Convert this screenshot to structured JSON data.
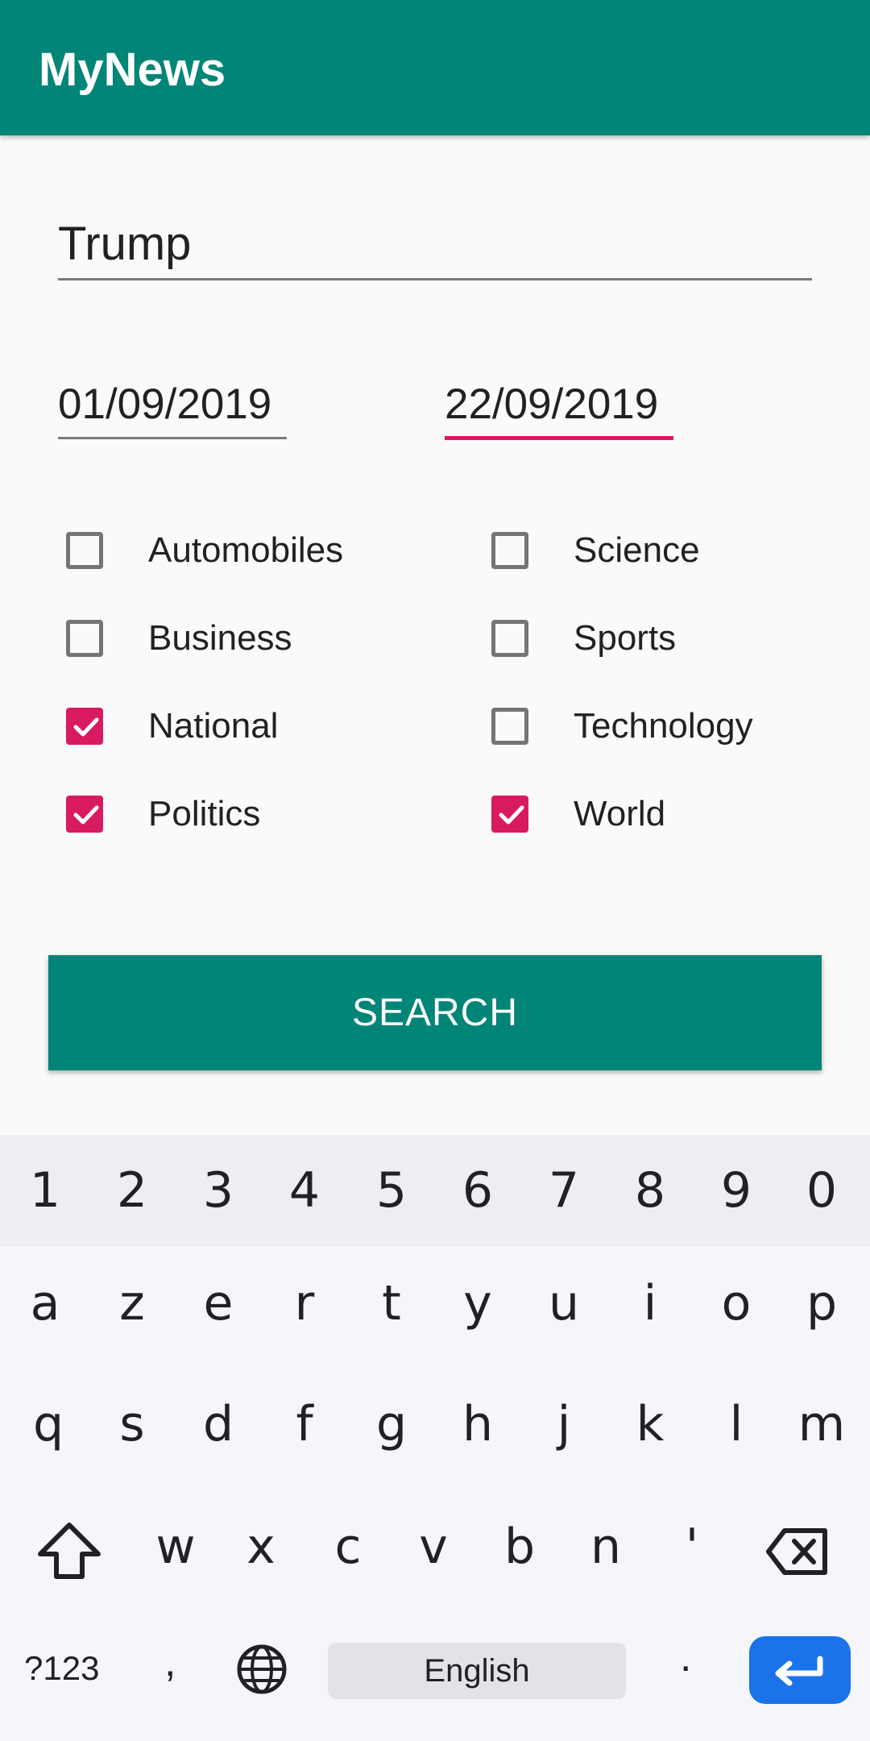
{
  "app": {
    "title": "MyNews"
  },
  "search": {
    "query": "Trump"
  },
  "dates": {
    "begin": "01/09/2019",
    "end": "22/09/2019"
  },
  "categories": [
    {
      "label": "Automobiles",
      "checked": false
    },
    {
      "label": "Science",
      "checked": false
    },
    {
      "label": "Business",
      "checked": false
    },
    {
      "label": "Sports",
      "checked": false
    },
    {
      "label": "National",
      "checked": true
    },
    {
      "label": "Technology",
      "checked": false
    },
    {
      "label": "Politics",
      "checked": true
    },
    {
      "label": "World",
      "checked": true
    }
  ],
  "button": {
    "search": "SEARCH"
  },
  "keyboard": {
    "numbers": [
      "1",
      "2",
      "3",
      "4",
      "5",
      "6",
      "7",
      "8",
      "9",
      "0"
    ],
    "row1": [
      "a",
      "z",
      "e",
      "r",
      "t",
      "y",
      "u",
      "i",
      "o",
      "p"
    ],
    "row2": [
      "q",
      "s",
      "d",
      "f",
      "g",
      "h",
      "j",
      "k",
      "l",
      "m"
    ],
    "row3": [
      "w",
      "x",
      "c",
      "v",
      "b",
      "n",
      "'"
    ],
    "symbols_label": "?123",
    "comma": ",",
    "space_label": "English",
    "period": "."
  },
  "colors": {
    "primary": "#008577",
    "accent": "#d81b60"
  },
  "icons": [
    "shift-icon",
    "backspace-icon",
    "globe-icon",
    "enter-icon",
    "checkmark-icon"
  ]
}
